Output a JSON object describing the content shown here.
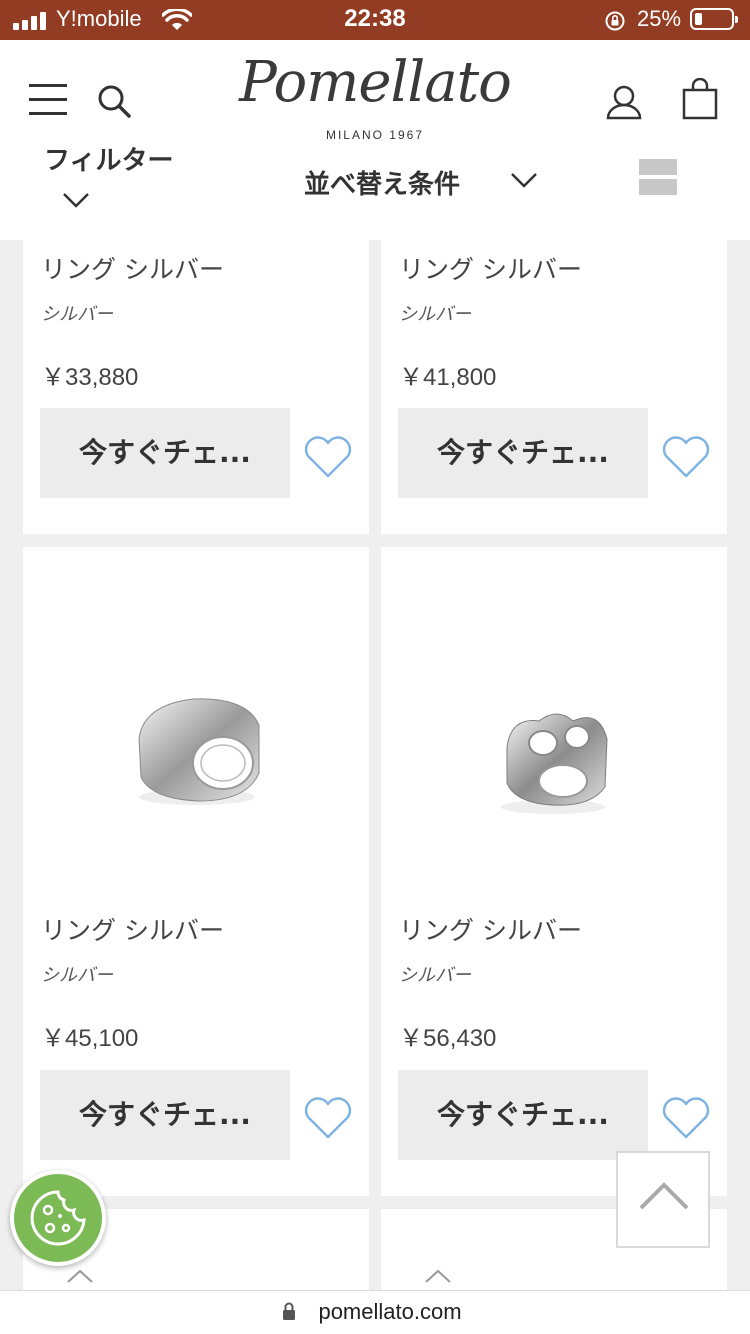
{
  "status_bar": {
    "carrier": "Y!mobile",
    "time": "22:38",
    "battery": "25%"
  },
  "header": {
    "logo": "Pomellato",
    "logo_sub": "MILANO 1967",
    "filter_label": "フィルター",
    "sort_label": "並べ替え条件"
  },
  "products": [
    {
      "name": "リング シルバー",
      "material": "シルバー",
      "price": "￥33,880",
      "button": "今すぐチェ..."
    },
    {
      "name": "リング シルバー",
      "material": "シルバー",
      "price": "￥41,800",
      "button": "今すぐチェ..."
    },
    {
      "name": "リング シルバー",
      "material": "シルバー",
      "price": "￥45,100",
      "button": "今すぐチェ...",
      "image": "silver-band-ring"
    },
    {
      "name": "リング シルバー",
      "material": "シルバー",
      "price": "￥56,430",
      "button": "今すぐチェ...",
      "image": "silver-chain-ring"
    }
  ],
  "browser": {
    "url": "pomellato.com"
  },
  "colors": {
    "status_bar": "#923c24",
    "heart": "#7fb3e0",
    "cookie": "#7cba55"
  }
}
